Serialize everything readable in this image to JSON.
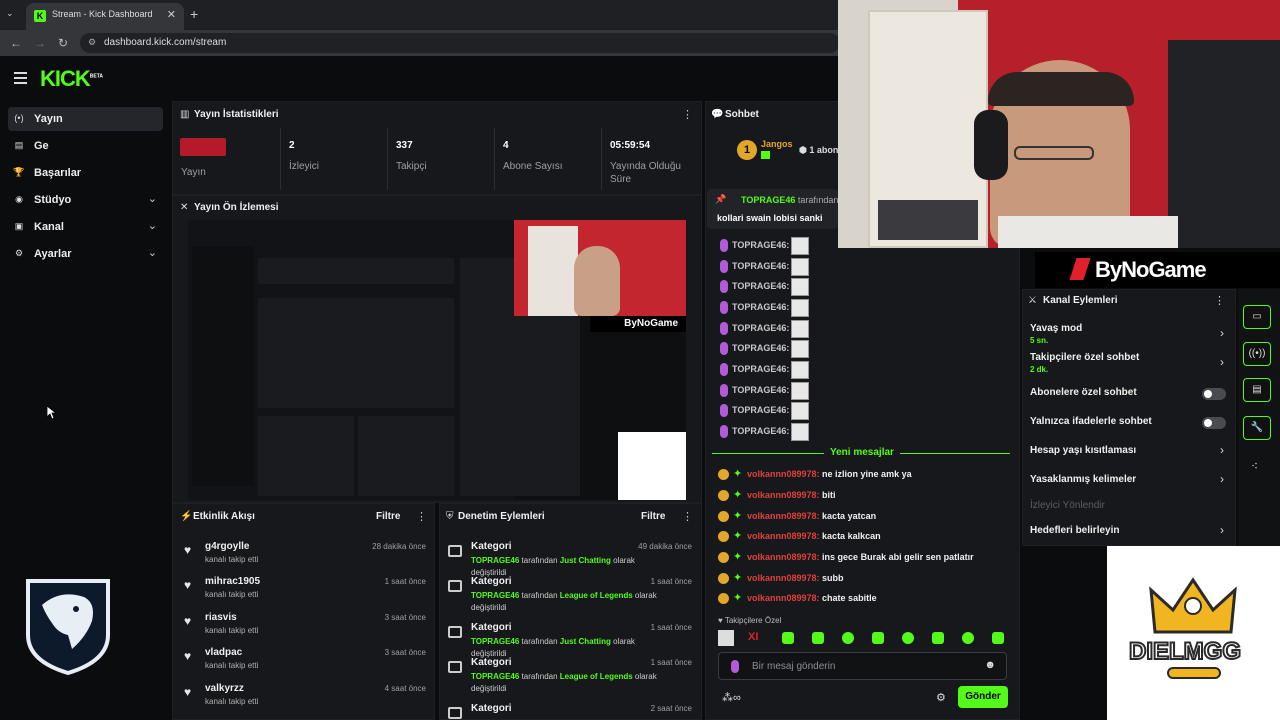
{
  "browser": {
    "tab_title": "Stream - Kick Dashboard",
    "tab_close": "✕",
    "new_tab": "+",
    "url": "dashboard.kick.com/stream"
  },
  "app": {
    "logo": "KICK",
    "logo_badge": "BETA"
  },
  "sidebar": {
    "items": [
      {
        "label": "Yayın",
        "icon": "broadcast-icon",
        "active": true
      },
      {
        "label": "Ge",
        "icon": "dashboard-icon"
      },
      {
        "label": "Başarılar",
        "icon": "trophy-icon"
      },
      {
        "label": "Stüdyo",
        "icon": "studio-icon",
        "chevron": true
      },
      {
        "label": "Kanal",
        "icon": "channel-icon",
        "chevron": true
      },
      {
        "label": "Ayarlar",
        "icon": "gear-icon",
        "chevron": true
      }
    ]
  },
  "stats": {
    "title": "Yayın İstatistikleri",
    "menu": "⋮",
    "cells": [
      {
        "value": "",
        "label": "Yayın"
      },
      {
        "value": "2",
        "label": "İzleyici"
      },
      {
        "value": "337",
        "label": "Takipçi"
      },
      {
        "value": "4",
        "label": "Abone Sayısı"
      },
      {
        "value": "05:59:54",
        "label": "Yayında Olduğu Süre"
      }
    ]
  },
  "preview": {
    "title": "Yayın Ön İzlemesi"
  },
  "activity": {
    "title": "Etkinlik Akışı",
    "filter": "Filtre",
    "menu": "⋮",
    "items": [
      {
        "name": "g4rgoylle",
        "sub": "kanalı takip etti",
        "time": "28 dakika önce"
      },
      {
        "name": "mihrac1905",
        "sub": "kanalı takip etti",
        "time": "1 saat önce"
      },
      {
        "name": "riasvis",
        "sub": "kanalı takip etti",
        "time": "3 saat önce"
      },
      {
        "name": "vladpac",
        "sub": "kanalı takip etti",
        "time": "3 saat önce"
      },
      {
        "name": "valkyrzz",
        "sub": "kanalı takip etti",
        "time": "4 saat önce"
      }
    ]
  },
  "moderation": {
    "title": "Denetim Eylemleri",
    "filter": "Filtre",
    "menu": "⋮",
    "items": [
      {
        "title": "Kategori",
        "user": "TOPRAGE46",
        "mid": " tarafından ",
        "category": "Just Chatting",
        "end": " olarak değiştirildi",
        "time": "49 dakika önce"
      },
      {
        "title": "Kategori",
        "user": "TOPRAGE46",
        "mid": " tarafından ",
        "category": "League of Legends",
        "end": " olarak değiştirildi",
        "time": "1 saat önce"
      },
      {
        "title": "Kategori",
        "user": "TOPRAGE46",
        "mid": " tarafından ",
        "category": "Just Chatting",
        "end": " olarak değiştirildi",
        "time": "1 saat önce"
      },
      {
        "title": "Kategori",
        "user": "TOPRAGE46",
        "mid": " tarafından ",
        "category": "League of Legends",
        "end": " olarak değiştirildi",
        "time": "1 saat önce"
      },
      {
        "title": "Kategori",
        "user": "",
        "mid": "",
        "category": "",
        "end": "",
        "time": "2 saat önce"
      }
    ]
  },
  "chat": {
    "title": "Sohbet",
    "pinned_user": "Jangos",
    "pinned_count": "1",
    "sub_label": "1 abon",
    "pin_by": "TOPRAGE46",
    "pin_by_suffix": " tarafından s",
    "pin_message": "kollari swain lobisi sanki",
    "emote_senders": [
      "TOPRAGE46:",
      "TOPRAGE46:",
      "TOPRAGE46:",
      "TOPRAGE46:",
      "TOPRAGE46:",
      "TOPRAGE46:",
      "TOPRAGE46:",
      "TOPRAGE46:",
      "TOPRAGE46:",
      "TOPRAGE46:"
    ],
    "new_messages": "Yeni mesajlar",
    "messages": [
      {
        "user": "volkannn089978:",
        "text": " ne izlion yine amk ya"
      },
      {
        "user": "volkannn089978:",
        "text": " biti"
      },
      {
        "user": "volkannn089978:",
        "text": " kacta yatcan"
      },
      {
        "user": "volkannn089978:",
        "text": " kacta kalkcan"
      },
      {
        "user": "volkannn089978:",
        "text": " ins gece Burak abi gelir sen patlatır"
      },
      {
        "user": "volkannn089978:",
        "text": " subb"
      },
      {
        "user": "volkannn089978:",
        "text": " chate sabitle"
      }
    ],
    "followers_only": "Takipçilere Özel",
    "input_placeholder": "Bir mesaj gönderin",
    "send": "Gönder"
  },
  "channel_actions": {
    "title": "Kanal Eylemleri",
    "menu": "⋮",
    "items": [
      {
        "title": "Yavaş mod",
        "sub": "5 sn.",
        "type": "chevron"
      },
      {
        "title": "Takipçilere özel sohbet",
        "sub": "2 dk.",
        "type": "chevron"
      },
      {
        "title": "Abonelere özel sohbet",
        "sub": "",
        "type": "toggle"
      },
      {
        "title": "Yalnızca ifadelerle sohbet",
        "sub": "",
        "type": "toggle"
      },
      {
        "title": "Hesap yaşı kısıtlaması",
        "sub": "",
        "type": "chevron"
      },
      {
        "title": "Yasaklanmış kelimeler",
        "sub": "",
        "type": "chevron"
      },
      {
        "title": "İzleyici Yönlendir",
        "sub": "",
        "type": "disabled"
      },
      {
        "title": "Hedefleri belirleyin",
        "sub": "",
        "type": "chevron"
      }
    ]
  },
  "overlays": {
    "bynogame": "ByNoGame",
    "dielmgg": "DIELMGG"
  },
  "colors": {
    "accent": "#53fc18",
    "panel": "#17181b",
    "bg": "#0b0c0e",
    "username_red": "#e0403a"
  }
}
